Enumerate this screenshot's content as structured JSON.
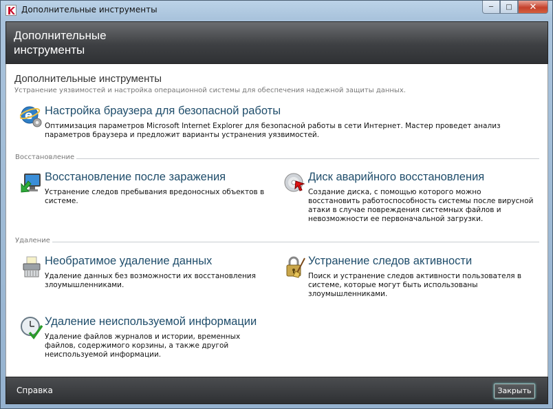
{
  "window": {
    "title": "Дополнительные инструменты",
    "caption": {
      "minimize": "─",
      "maximize": "□",
      "close": "✕"
    }
  },
  "header": {
    "title": "Дополнительные инструменты"
  },
  "main": {
    "title": "Дополнительные инструменты",
    "subtitle": "Устранение уязвимостей и настройка операционной системы для обеспечения надежной защиты данных."
  },
  "items": {
    "browser": {
      "icon": "ie-gear-icon",
      "title": "Настройка браузера для безопасной работы",
      "desc": "Оптимизация параметров Microsoft Internet Explorer для безопасной работы в сети Интернет. Мастер проведет анализ параметров браузера и предложит варианты устранения уязвимостей."
    },
    "recovery": {
      "icon": "monitor-restore-icon",
      "title": "Восстановление после заражения",
      "desc": "Устранение следов пребывания вредоносных объектов в системе."
    },
    "rescue_disk": {
      "icon": "rescue-disk-icon",
      "title": "Диск аварийного восстановления",
      "desc": "Создание диска, с помощью которого можно восстановить работоспособность системы после вирусной атаки в случае повреждения системных файлов и невозможности ее первоначальной загрузки."
    },
    "shredder": {
      "icon": "shredder-icon",
      "title": "Необратимое удаление данных",
      "desc": "Удаление данных без возможности их восстановления злоумышленниками."
    },
    "privacy": {
      "icon": "lock-broom-icon",
      "title": "Устранение следов активности",
      "desc": "Поиск и устранение следов активности пользователя в системе, которые могут быть использованы злоумышленниками."
    },
    "cleanup": {
      "icon": "clock-check-icon",
      "title": "Удаление неиспользуемой информации",
      "desc": "Удаление файлов журналов и истории, временных файлов, содержимого корзины, а также другой неиспользуемой информации."
    }
  },
  "sections": {
    "restore": "Восстановление",
    "delete": "Удаление"
  },
  "footer": {
    "help": "Справка",
    "close": "Закрыть"
  },
  "colors": {
    "link": "#1f4d6b",
    "header_bg": "#3e4043",
    "footer_bg": "#2e3033"
  }
}
